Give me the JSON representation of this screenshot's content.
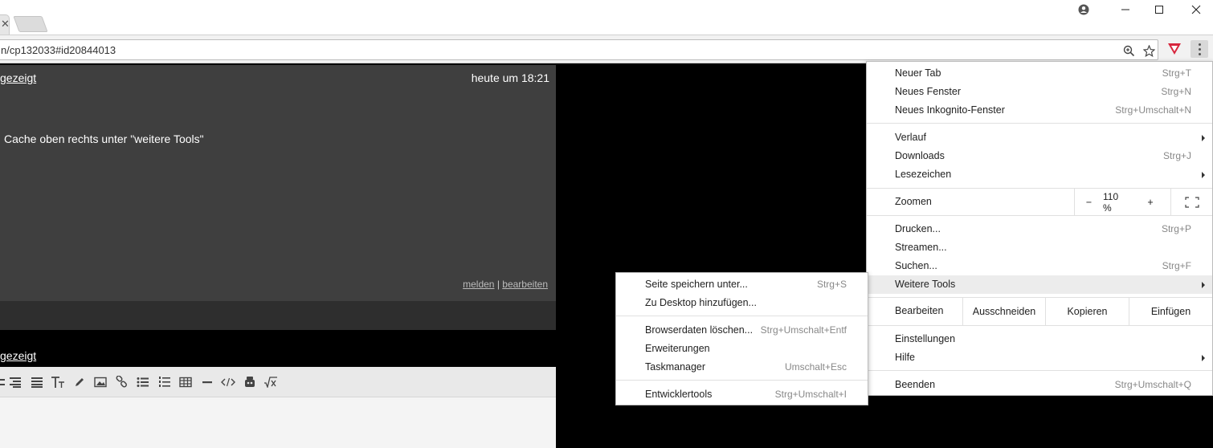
{
  "browser": {
    "url": "n/cp132033#id20844013",
    "tab_close": "✕"
  },
  "page": {
    "post": {
      "author": "gezeigt",
      "time": "heute um 18:21",
      "text": "Cache oben rechts unter \"weitere Tools\"",
      "report_link": "melden",
      "separator": "|",
      "edit_link": "bearbeiten"
    },
    "reply_author": "gezeigt"
  },
  "menu": {
    "new_tab": {
      "label": "Neuer Tab",
      "shortcut": "Strg+T"
    },
    "new_window": {
      "label": "Neues Fenster",
      "shortcut": "Strg+N"
    },
    "incognito": {
      "label": "Neues Inkognito-Fenster",
      "shortcut": "Strg+Umschalt+N"
    },
    "history": {
      "label": "Verlauf"
    },
    "downloads": {
      "label": "Downloads",
      "shortcut": "Strg+J"
    },
    "bookmarks": {
      "label": "Lesezeichen"
    },
    "zoom": {
      "label": "Zoomen",
      "minus": "−",
      "value": "110 %",
      "plus": "+"
    },
    "print": {
      "label": "Drucken...",
      "shortcut": "Strg+P"
    },
    "cast": {
      "label": "Streamen..."
    },
    "find": {
      "label": "Suchen...",
      "shortcut": "Strg+F"
    },
    "more_tools": {
      "label": "Weitere Tools"
    },
    "edit": {
      "label": "Bearbeiten",
      "cut": "Ausschneiden",
      "copy": "Kopieren",
      "paste": "Einfügen"
    },
    "settings": {
      "label": "Einstellungen"
    },
    "help": {
      "label": "Hilfe"
    },
    "exit": {
      "label": "Beenden",
      "shortcut": "Strg+Umschalt+Q"
    }
  },
  "submenu": {
    "save_page": {
      "label": "Seite speichern unter...",
      "shortcut": "Strg+S"
    },
    "add_desktop": {
      "label": "Zu Desktop hinzufügen..."
    },
    "clear_data": {
      "label": "Browserdaten löschen...",
      "shortcut": "Strg+Umschalt+Entf"
    },
    "extensions": {
      "label": "Erweiterungen"
    },
    "task_manager": {
      "label": "Taskmanager",
      "shortcut": "Umschalt+Esc"
    },
    "dev_tools": {
      "label": "Entwicklertools",
      "shortcut": "Strg+Umschalt+I"
    }
  },
  "colors": {
    "post_bg": "#3f3f3f",
    "highlight": "#ececec",
    "extension_red": "#d7263d"
  }
}
